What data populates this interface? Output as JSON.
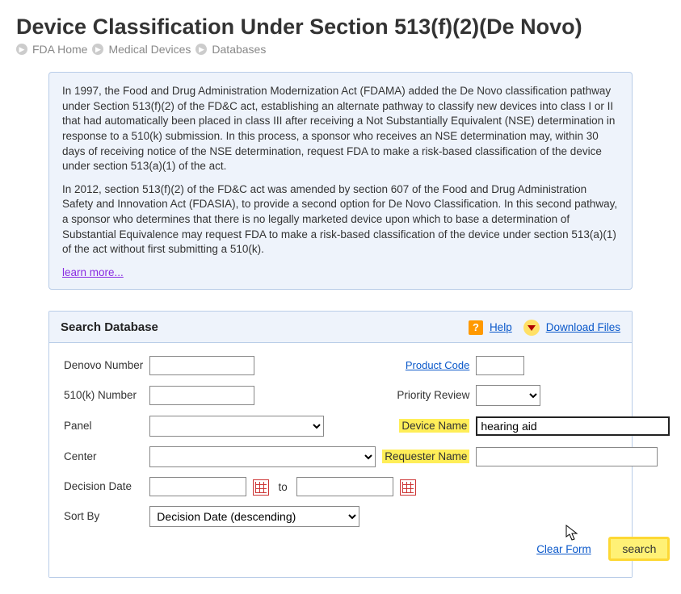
{
  "page_title": "Device Classification Under Section 513(f)(2)(De Novo)",
  "breadcrumb": {
    "items": [
      "FDA Home",
      "Medical Devices",
      "Databases"
    ]
  },
  "info": {
    "para1": "In 1997, the Food and Drug Administration Modernization Act (FDAMA) added the De Novo classification pathway under Section 513(f)(2) of the FD&C act, establishing an alternate pathway to classify new devices into class I or II that had automatically been placed in class III after receiving a Not Substantially Equivalent (NSE) determination in response to a 510(k) submission. In this process, a sponsor who receives an NSE determination may, within 30 days of receiving notice of the NSE determination, request FDA to make a risk-based classification of the device under section 513(a)(1) of the act.",
    "para2": "In 2012, section 513(f)(2) of the FD&C act was amended by section 607 of the Food and Drug Administration Safety and Innovation Act (FDASIA), to provide a second option for De Novo Classification. In this second pathway, a sponsor who determines that there is no legally marketed device upon which to base a determination of Substantial Equivalence may request FDA to make a risk-based classification of the device under section 513(a)(1) of the act without first submitting a 510(k).",
    "learn_more": "learn more..."
  },
  "search_header": {
    "title": "Search Database",
    "help_label": "Help",
    "download_label": "Download Files"
  },
  "form": {
    "labels": {
      "denovo_number": "Denovo Number",
      "k_number": "510(k) Number",
      "panel": "Panel",
      "center": "Center",
      "decision_date": "Decision Date",
      "to": "to",
      "sort_by": "Sort By",
      "product_code": "Product Code",
      "priority_review": "Priority Review",
      "device_name": "Device Name",
      "requester_name": "Requester Name"
    },
    "values": {
      "denovo_number": "",
      "k_number": "",
      "panel": "",
      "center": "",
      "decision_date_from": "",
      "decision_date_to": "",
      "sort_by": "Decision Date (descending)",
      "product_code": "",
      "priority_review": "",
      "device_name": "hearing aid",
      "requester_name": ""
    },
    "actions": {
      "clear": "Clear Form",
      "search": "search"
    }
  }
}
